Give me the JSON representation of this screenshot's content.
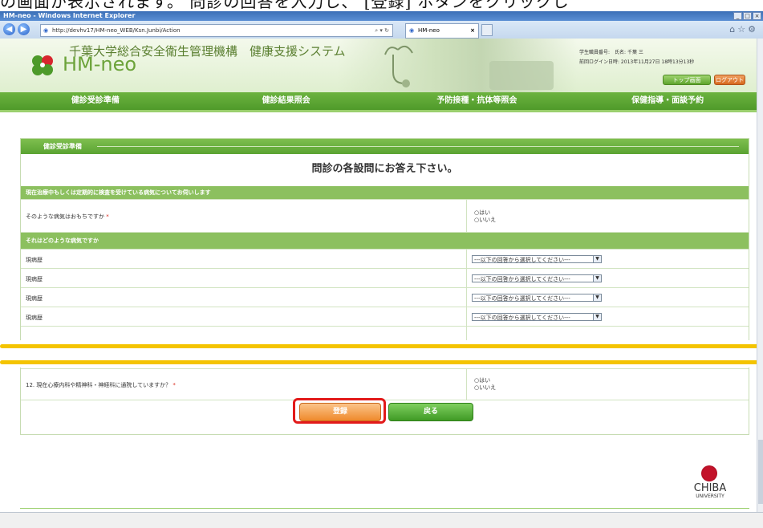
{
  "doc_caption": "の画面が表示されます。 問診の回答を入力し、 [登録] ボタンをクリックし",
  "ie": {
    "title": "HM-neo - Windows Internet Explorer",
    "url": "http://devhv17/HM-neo_WEB/Ksn.Junbi/Action",
    "tab_label": "HM-neo",
    "window_buttons": [
      "_",
      "□",
      "×"
    ]
  },
  "header": {
    "org_name": "千葉大学総合安全衛生管理機構　健康支援システム",
    "logo_text": "HM-neo",
    "user_line1": "学生職員番号:　氏名: 千葉 三",
    "user_line2": "前回ログイン日時: 2013年11月27日 18時13分13秒",
    "top_button": "トップ画面",
    "logout_button": "ログアウト"
  },
  "nav": {
    "items": [
      "健診受診準備",
      "健診結果照会",
      "予防接種・抗体等照会",
      "保健指導・面談予約"
    ]
  },
  "panel": {
    "heading": "健診受診準備",
    "form_title": "問診の各設問にお答え下さい。",
    "section1": "現在治療中もしくは定期的に検査を受けている病気についてお伺いします",
    "q1_text": "そのような病気はおもちですか",
    "q1_required": "*",
    "radio_yes": "○はい",
    "radio_no": "○いいえ",
    "section2": "それはどのような病気ですか",
    "history_label": "現病歴",
    "select_placeholder": "---以下の回答から選択してください---",
    "q12_text": "12. 現在心療内科や精神科・神経科に通院していますか？",
    "q12_required": "*"
  },
  "buttons": {
    "register": "登録",
    "back": "戻る"
  },
  "footer": {
    "logo_text": "CHIBA",
    "logo_sub": "UNIVERSITY"
  },
  "colors": {
    "accent_green": "#5aa332",
    "register_orange": "#ef8a2c",
    "highlight_red": "#e21a1a",
    "band_yellow": "#f4c400"
  }
}
